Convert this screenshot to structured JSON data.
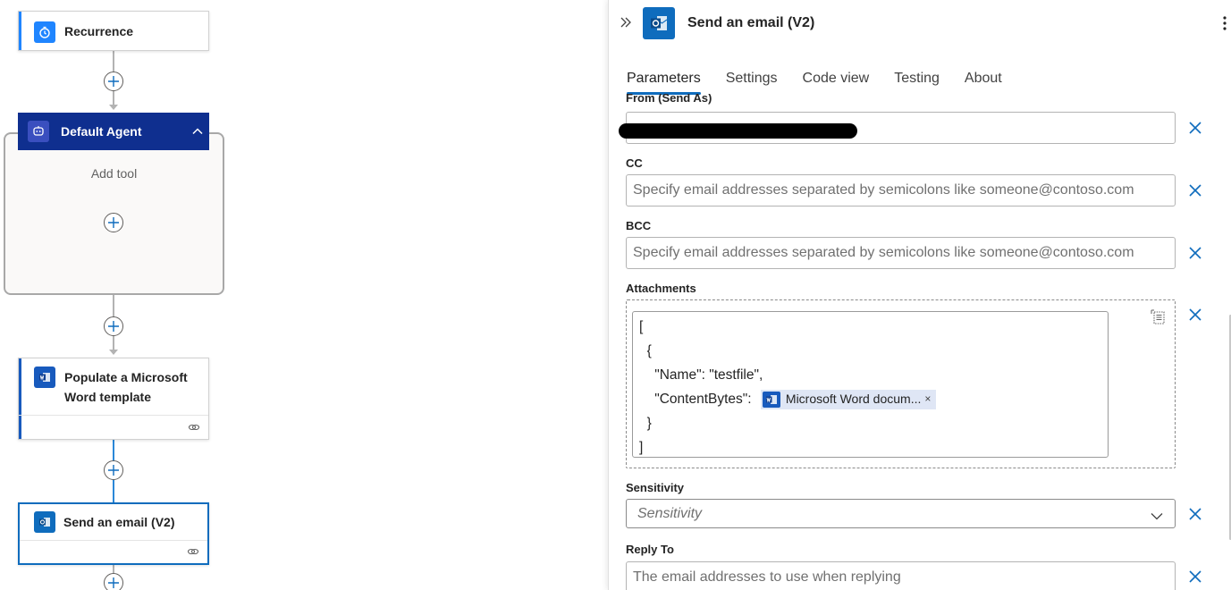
{
  "flow": {
    "recurrence": {
      "title": "Recurrence",
      "icon": "clock-icon",
      "accent": "#1f85ff"
    },
    "agent": {
      "title": "Default Agent",
      "add_tool_label": "Add tool",
      "header_color": "#0f2f8f"
    },
    "word_action": {
      "title": "Populate a Microsoft Word template",
      "icon": "word-icon",
      "accent": "#185abd"
    },
    "email_action": {
      "title": "Send an email (V2)",
      "icon": "outlook-icon",
      "accent": "#0f6cbd"
    }
  },
  "panel": {
    "title": "Send an email (V2)",
    "tabs": [
      {
        "label": "Parameters",
        "active": true
      },
      {
        "label": "Settings"
      },
      {
        "label": "Code view"
      },
      {
        "label": "Testing"
      },
      {
        "label": "About"
      }
    ],
    "fields": {
      "from": {
        "label": "From (Send As)"
      },
      "cc": {
        "label": "CC",
        "placeholder": "Specify email addresses separated by semicolons like someone@contoso.com"
      },
      "bcc": {
        "label": "BCC",
        "placeholder": "Specify email addresses separated by semicolons like someone@contoso.com"
      },
      "attachments": {
        "label": "Attachments",
        "lines": [
          "[",
          "  {",
          "    \"Name\": \"testfile\",",
          "    \"ContentBytes\": ",
          "  }",
          "]"
        ],
        "token": {
          "label": "Microsoft Word docum...",
          "remove": "×"
        }
      },
      "sensitivity": {
        "label": "Sensitivity",
        "placeholder": "Sensitivity"
      },
      "reply_to": {
        "label": "Reply To",
        "placeholder": "The email addresses to use when replying"
      }
    }
  }
}
